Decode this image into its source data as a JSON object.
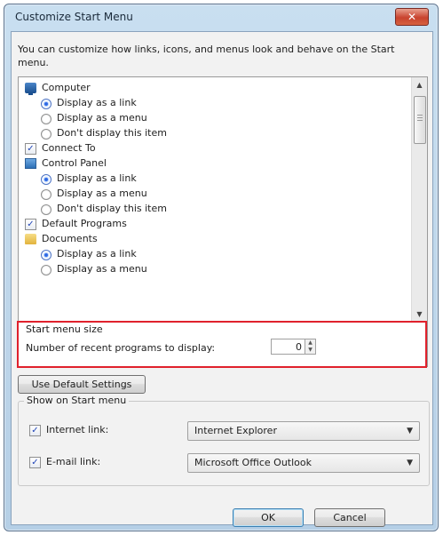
{
  "window": {
    "title": "Customize Start Menu",
    "close_label": "✕"
  },
  "intro": "You can customize how links, icons, and menus look and behave on the Start menu.",
  "list_items": [
    {
      "type": "header",
      "icon": "computer-icon",
      "label": "Computer"
    },
    {
      "type": "radio",
      "label": "Display as a link",
      "checked": true
    },
    {
      "type": "radio",
      "label": "Display as a menu",
      "checked": false
    },
    {
      "type": "radio",
      "label": "Don't display this item",
      "checked": false
    },
    {
      "type": "checkbox",
      "label": "Connect To",
      "checked": true
    },
    {
      "type": "header",
      "icon": "control-panel-icon",
      "label": "Control Panel"
    },
    {
      "type": "radio",
      "label": "Display as a link",
      "checked": true
    },
    {
      "type": "radio",
      "label": "Display as a menu",
      "checked": false
    },
    {
      "type": "radio",
      "label": "Don't display this item",
      "checked": false
    },
    {
      "type": "checkbox",
      "label": "Default Programs",
      "checked": true
    },
    {
      "type": "header",
      "icon": "folder-icon",
      "label": "Documents"
    },
    {
      "type": "radio",
      "label": "Display as a link",
      "checked": true
    },
    {
      "type": "radio",
      "label": "Display as a menu",
      "checked": false
    }
  ],
  "start_menu_size": {
    "title": "Start menu size",
    "recent_label": "Number of recent programs to display:",
    "recent_value": "0"
  },
  "buttons": {
    "use_default": "Use Default Settings",
    "ok": "OK",
    "cancel": "Cancel"
  },
  "show_on_start_menu": {
    "title": "Show on Start menu",
    "internet_label": "Internet link:",
    "internet_checked": true,
    "internet_value": "Internet Explorer",
    "email_label": "E-mail link:",
    "email_checked": true,
    "email_value": "Microsoft Office Outlook"
  },
  "colors": {
    "highlight_border": "#e0212c",
    "close_button": "#c8432e",
    "title_bar": "#c9dff0"
  }
}
